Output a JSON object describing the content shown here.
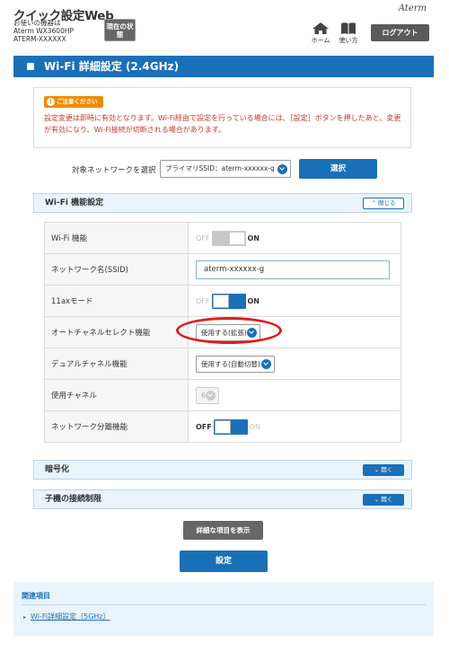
{
  "header": {
    "app_title": "クイック設定Web",
    "device_caption": "お使いの機器は",
    "device_model": "Aterm WX3600HP",
    "device_id": "ATERM-XXXXXX",
    "status_button": "現在の状態",
    "brand": "Aterm",
    "home_label": "ホーム",
    "help_label": "使い方",
    "logout_button": "ログアウト"
  },
  "page_title": "Wi-Fi 詳細設定 (2.4GHz)",
  "notice": {
    "tag": "ご注意ください",
    "message": "設定変更は即時に有効となります。Wi-Fi経由で設定を行っている場合には、［設定］ボタンを押したあと、変更が有効になり、Wi-Fi接続が切断される場合があります。"
  },
  "network_select": {
    "label": "対象ネットワークを選択",
    "value": "プライマリSSID：aterm-xxxxxx-g",
    "button": "選択"
  },
  "wifi_section": {
    "title": "Wi-Fi 機能設定",
    "toggle": "閉じる",
    "rows": [
      {
        "label": "Wi-Fi 機能",
        "off": "OFF",
        "on": "ON",
        "enabled": true
      },
      {
        "label": "ネットワーク名(SSID)",
        "value": "aterm-xxxxxx-g"
      },
      {
        "label": "11axモード",
        "off": "OFF",
        "on": "ON",
        "enabled": true
      },
      {
        "label": "オートチャネルセレクト機能",
        "value": "使用する(拡張)"
      },
      {
        "label": "デュアルチャネル機能",
        "value": "使用する(自動切替)"
      },
      {
        "label": "使用チャネル",
        "value": "6"
      },
      {
        "label": "ネットワーク分離機能",
        "off": "OFF",
        "on": "ON",
        "enabled": false
      }
    ]
  },
  "encryption_section": {
    "title": "暗号化",
    "toggle": "開く"
  },
  "client_section": {
    "title": "子機の接続制限",
    "toggle": "開く"
  },
  "detail_button": "詳細な項目を表示",
  "apply_button": "設定",
  "related": {
    "title": "関連項目",
    "link": "Wi-Fi詳細設定（5GHz）"
  },
  "colors": {
    "accent": "#1a70b8",
    "warning": "#c0392b",
    "highlight": "#e41b1b"
  }
}
